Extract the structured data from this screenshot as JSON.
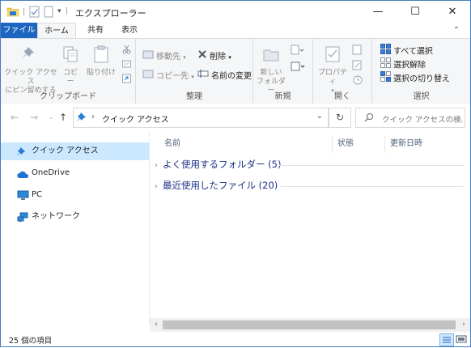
{
  "window": {
    "title": "エクスプローラー",
    "controls": {
      "minimize": "—",
      "maximize": "☐",
      "close": "✕"
    }
  },
  "tabs": [
    {
      "label": "ファイル"
    },
    {
      "label": "ホーム"
    },
    {
      "label": "共有"
    },
    {
      "label": "表示"
    }
  ],
  "ribbon": {
    "clipboard": {
      "label": "クリップボード",
      "pin_line1": "クイック アクセス",
      "pin_line2": "にピン留めする",
      "copy": "コピー",
      "paste": "貼り付け"
    },
    "organize": {
      "label": "整理",
      "move_to": "移動先",
      "copy_to": "コピー先",
      "delete": "削除",
      "rename": "名前の変更"
    },
    "new": {
      "label": "新規",
      "new_folder_line1": "新しい",
      "new_folder_line2": "フォルダー"
    },
    "open": {
      "label": "開く",
      "properties": "プロパティ"
    },
    "select": {
      "label": "選択",
      "select_all": "すべて選択",
      "select_none": "選択解除",
      "invert": "選択の切り替え"
    }
  },
  "address": {
    "path": "クイック アクセス",
    "search_placeholder": "クイック アクセスの検..."
  },
  "nav_pane": {
    "items": [
      {
        "label": "クイック アクセス",
        "icon": "pin-icon",
        "selected": true
      },
      {
        "label": "OneDrive",
        "icon": "cloud-icon",
        "selected": false
      },
      {
        "label": "PC",
        "icon": "computer-icon",
        "selected": false
      },
      {
        "label": "ネットワーク",
        "icon": "network-icon",
        "selected": false
      }
    ]
  },
  "content": {
    "columns": [
      "名前",
      "状態",
      "更新日時"
    ],
    "groups": [
      {
        "label": "よく使用するフォルダー (5)"
      },
      {
        "label": "最近使用したファイル (20)"
      }
    ]
  },
  "status": {
    "item_count": "25 個の項目"
  },
  "colors": {
    "accent": "#1c65c0",
    "selection": "#cce8ff",
    "group_text": "#1e3287"
  }
}
